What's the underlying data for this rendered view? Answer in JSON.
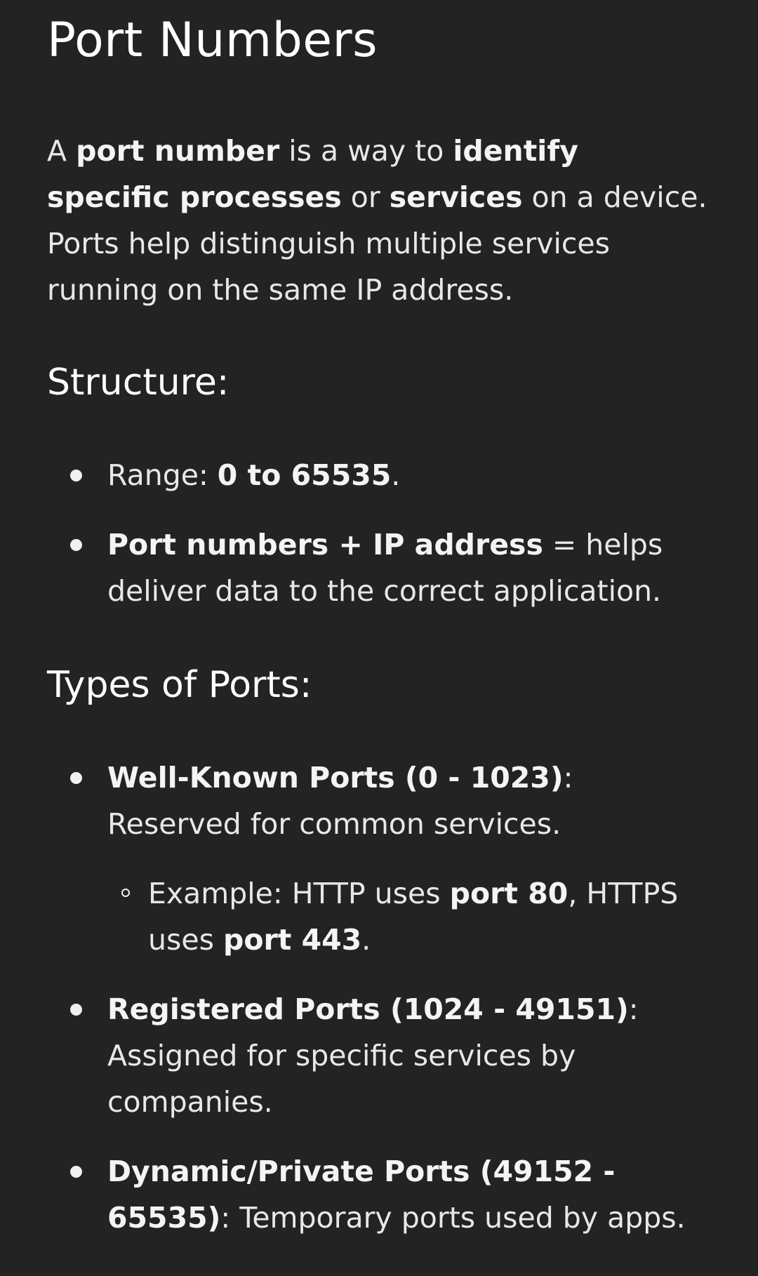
{
  "title": "Port Numbers",
  "intro": {
    "p1": "A ",
    "p2": "port number",
    "p3": " is a way to ",
    "p4": "identify specific processes",
    "p5": " or ",
    "p6": "services",
    "p7": " on a device.",
    "line2": "Ports help distinguish multiple services running on the same IP address."
  },
  "structure": {
    "heading": "Structure:",
    "items": [
      {
        "plain": "Range: ",
        "bold": "0 to 65535",
        "tail": "."
      },
      {
        "bold": "Port numbers + IP address",
        "tail": " = helps deliver data to the correct application."
      }
    ]
  },
  "types": {
    "heading": "Types of Ports:",
    "well_known": {
      "bold": "Well-Known Ports (0 - 1023)",
      "tail": ": Reserved for common services.",
      "example": {
        "p1": "Example: HTTP uses ",
        "p2": "port 80",
        "p3": ", HTTPS uses ",
        "p4": "port 443",
        "p5": "."
      }
    },
    "registered": {
      "bold": "Registered Ports (1024 - 49151)",
      "tail": ": Assigned for specific services by companies."
    },
    "dynamic": {
      "bold": "Dynamic/Private Ports (49152 - 65535)",
      "tail": ": Temporary ports used by apps."
    }
  }
}
